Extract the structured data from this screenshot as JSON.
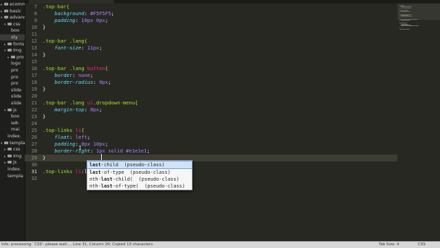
{
  "tabs": [
    "",
    ""
  ],
  "sidebar": {
    "items": [
      {
        "label": "ecommerce",
        "level": 0,
        "type": "folder",
        "open": false
      },
      {
        "label": "basic",
        "level": 0,
        "type": "folder",
        "open": false
      },
      {
        "label": "advance",
        "level": 0,
        "type": "folder",
        "open": true
      },
      {
        "label": "css",
        "level": 1,
        "type": "folder",
        "open": true
      },
      {
        "label": "boo",
        "level": 2,
        "type": "file"
      },
      {
        "label": "sty",
        "level": 2,
        "type": "file",
        "selected": true
      },
      {
        "label": "fonts",
        "level": 1,
        "type": "folder",
        "open": false
      },
      {
        "label": "img",
        "level": 1,
        "type": "folder",
        "open": true
      },
      {
        "label": "pro",
        "level": 2,
        "type": "folder"
      },
      {
        "label": "logo",
        "level": 2,
        "type": "file"
      },
      {
        "label": "pro",
        "level": 2,
        "type": "file"
      },
      {
        "label": "pro",
        "level": 2,
        "type": "file"
      },
      {
        "label": "pro",
        "level": 2,
        "type": "file"
      },
      {
        "label": "slide",
        "level": 2,
        "type": "file"
      },
      {
        "label": "slide",
        "level": 2,
        "type": "file"
      },
      {
        "label": "slide",
        "level": 2,
        "type": "file"
      },
      {
        "label": "js",
        "level": 1,
        "type": "folder",
        "open": true
      },
      {
        "label": "boo",
        "level": 2,
        "type": "file"
      },
      {
        "label": "ie8-",
        "level": 2,
        "type": "file"
      },
      {
        "label": "mai",
        "level": 2,
        "type": "file"
      },
      {
        "label": "index.",
        "level": 1,
        "type": "file"
      },
      {
        "label": "template",
        "level": 0,
        "type": "folder",
        "open": true
      },
      {
        "label": "css",
        "level": 1,
        "type": "folder",
        "open": false
      },
      {
        "label": "img",
        "level": 1,
        "type": "folder",
        "open": false
      },
      {
        "label": "js",
        "level": 1,
        "type": "folder",
        "open": false
      },
      {
        "label": "index.",
        "level": 1,
        "type": "file"
      },
      {
        "label": "templa",
        "level": 1,
        "type": "file"
      }
    ]
  },
  "editor": {
    "line_numbers": [
      "7",
      "8",
      "9",
      "10",
      "11",
      "12",
      "13",
      "14",
      "15",
      "16",
      "17",
      "18",
      "19",
      "20",
      "21",
      "22",
      "23",
      "24",
      "25",
      "26",
      "27",
      "28",
      "29",
      "30",
      "31",
      "32"
    ],
    "current_line": "31",
    "lines": [
      [
        {
          "t": ".top-bar{",
          "c": "sel-c"
        }
      ],
      [
        {
          "t": "    background",
          "c": "prop"
        },
        {
          "t": ": ",
          "c": ""
        },
        {
          "t": "#F5F5F5",
          "c": "val"
        },
        {
          "t": ";",
          "c": ""
        }
      ],
      [
        {
          "t": "    padding",
          "c": "prop"
        },
        {
          "t": ": ",
          "c": ""
        },
        {
          "t": "10px 0px",
          "c": "val"
        },
        {
          "t": ";",
          "c": ""
        }
      ],
      [
        {
          "t": "}",
          "c": ""
        }
      ],
      [],
      [
        {
          "t": ".top-bar .lang{",
          "c": "sel-c"
        }
      ],
      [
        {
          "t": "    font-size",
          "c": "prop"
        },
        {
          "t": ": ",
          "c": ""
        },
        {
          "t": "11px",
          "c": "val"
        },
        {
          "t": ";",
          "c": ""
        }
      ],
      [
        {
          "t": "}",
          "c": ""
        }
      ],
      [],
      [
        {
          "t": ".top-bar .lang ",
          "c": "sel-c"
        },
        {
          "t": "button",
          "c": "kw"
        },
        {
          "t": "{",
          "c": "sel-c"
        }
      ],
      [
        {
          "t": "    border",
          "c": "prop"
        },
        {
          "t": ": ",
          "c": ""
        },
        {
          "t": "none",
          "c": "val"
        },
        {
          "t": ";",
          "c": ""
        }
      ],
      [
        {
          "t": "    border-radius",
          "c": "prop"
        },
        {
          "t": ": ",
          "c": ""
        },
        {
          "t": "0px",
          "c": "val"
        },
        {
          "t": ";",
          "c": ""
        }
      ],
      [
        {
          "t": "}",
          "c": ""
        }
      ],
      [],
      [
        {
          "t": ".top-bar .lang ",
          "c": "sel-c"
        },
        {
          "t": "ul",
          "c": "kw"
        },
        {
          "t": ".dropdown-menu{",
          "c": "sel-c"
        }
      ],
      [
        {
          "t": "    margin-top",
          "c": "prop"
        },
        {
          "t": ": ",
          "c": ""
        },
        {
          "t": "0px",
          "c": "val"
        },
        {
          "t": ";",
          "c": ""
        }
      ],
      [
        {
          "t": "}",
          "c": ""
        }
      ],
      [],
      [
        {
          "t": ".top-links ",
          "c": "sel-c"
        },
        {
          "t": "li",
          "c": "kw"
        },
        {
          "t": "{",
          "c": "sel-c"
        }
      ],
      [
        {
          "t": "    float",
          "c": "prop"
        },
        {
          "t": ": ",
          "c": ""
        },
        {
          "t": "left",
          "c": "val"
        },
        {
          "t": ";",
          "c": ""
        }
      ],
      [
        {
          "t": "    padding",
          "c": "prop"
        },
        {
          "t": ": ",
          "c": ""
        },
        {
          "t": "0px 10px",
          "c": "val"
        },
        {
          "t": ";",
          "c": ""
        }
      ],
      [
        {
          "t": "    border-right",
          "c": "prop"
        },
        {
          "t": ": ",
          "c": ""
        },
        {
          "t": "1px solid #e1e1e1",
          "c": "val"
        },
        {
          "t": ";",
          "c": ""
        }
      ],
      [
        {
          "t": "}",
          "c": ""
        }
      ],
      [],
      [
        {
          "t": ".top-links ",
          "c": "sel-c"
        },
        {
          "t": "li",
          "c": "kw"
        },
        {
          "t": ":last-",
          "c": ""
        }
      ],
      []
    ]
  },
  "autocomplete": {
    "items": [
      {
        "pre": "",
        "match": "last",
        "post": "-child",
        "kind": "(pseudo-class)",
        "active": true
      },
      {
        "pre": "",
        "match": "last",
        "post": "-of-type",
        "kind": "(pseudo-class)",
        "active": false
      },
      {
        "pre": "nth-",
        "match": "last",
        "post": "-child(",
        "kind": "(pseudo-class)",
        "active": false
      },
      {
        "pre": "nth-",
        "match": "last",
        "post": "-of-type(",
        "kind": "(pseudo-class)",
        "active": false
      }
    ]
  },
  "status": {
    "left": "Info: processing `CSS': please wait.... Line 31, Column 20; Copied 13 characters",
    "tab_size": "Tab Size: 4",
    "syntax": "CSS"
  },
  "colors": {
    "background": "#272822",
    "selector": "#a6e22e",
    "property": "#66d9ef",
    "value": "#ae81ff",
    "keyword": "#f92672"
  }
}
